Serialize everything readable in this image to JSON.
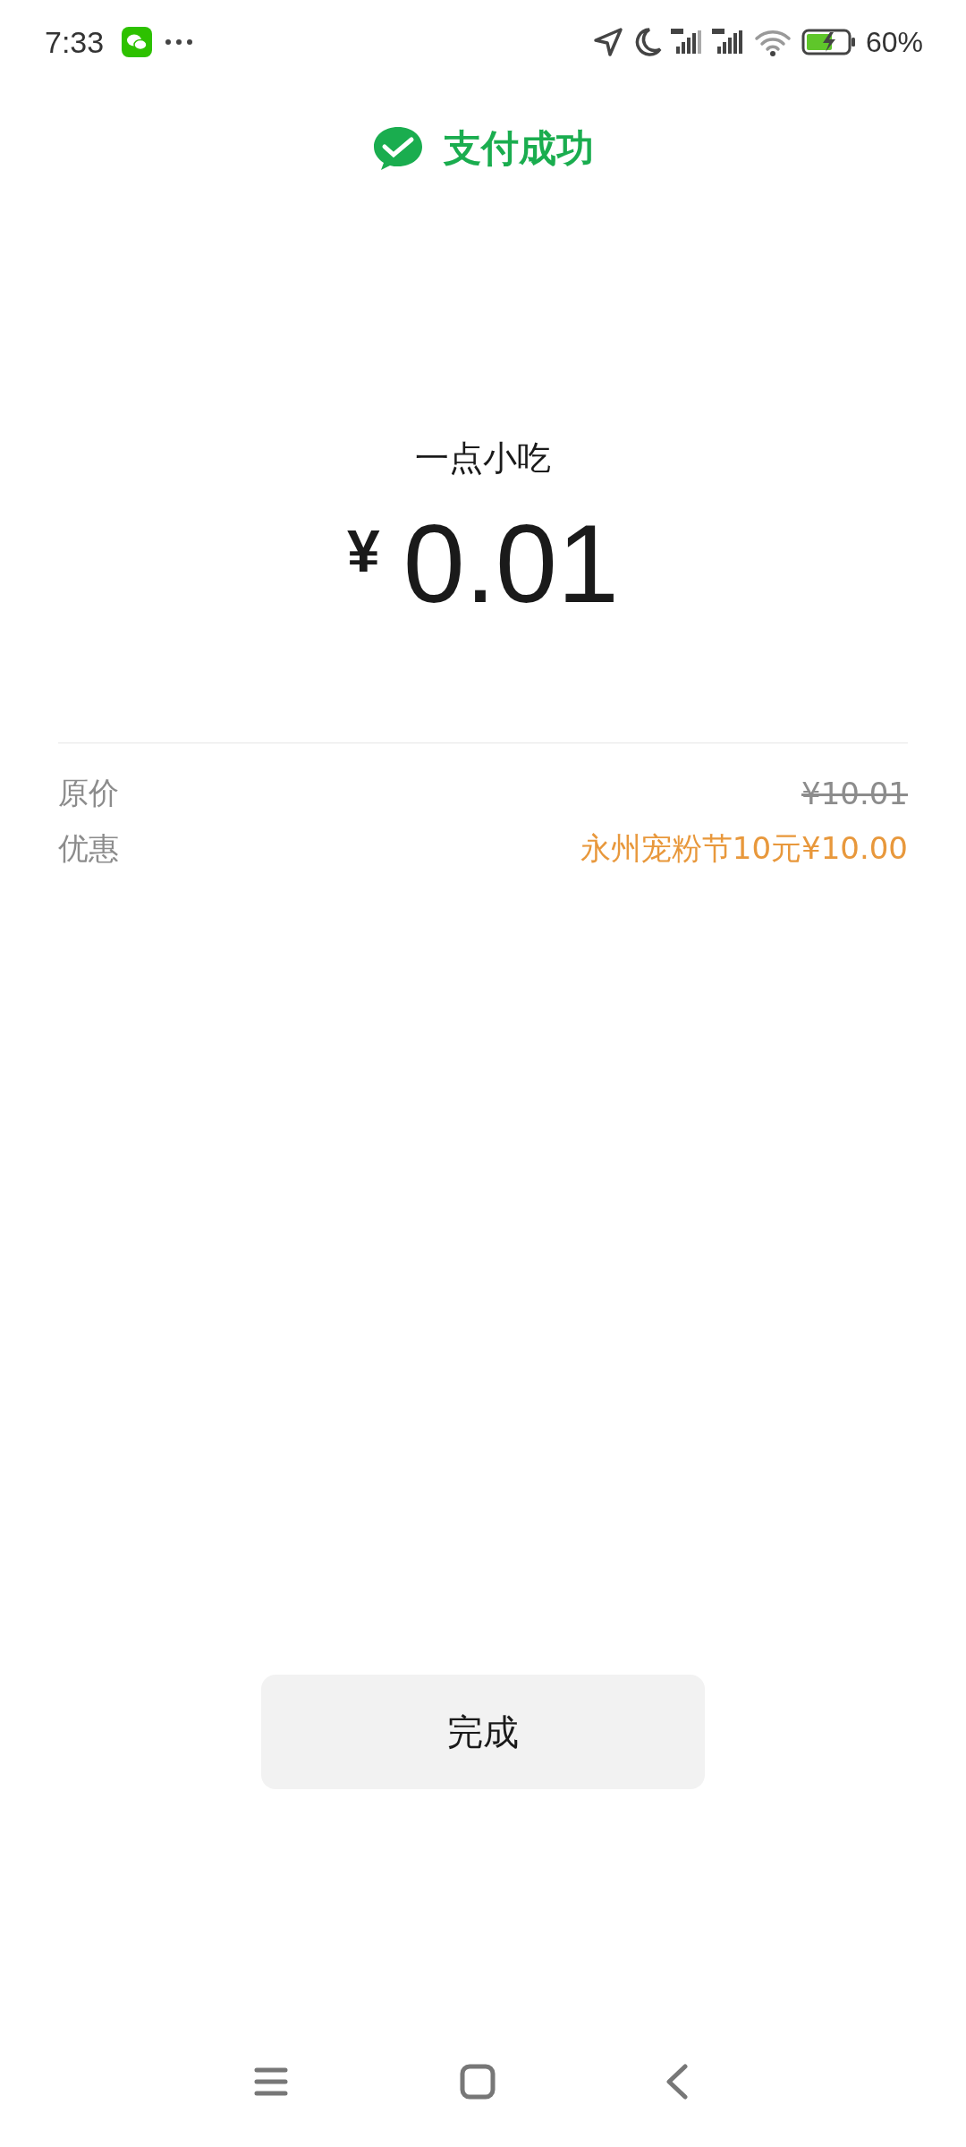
{
  "status_bar": {
    "time": "7:33",
    "battery": "60%"
  },
  "header": {
    "title": "支付成功"
  },
  "merchant": "一点小吃",
  "amount": {
    "currency": "¥",
    "value": "0.01"
  },
  "details": [
    {
      "label": "原价",
      "value": "¥10.01",
      "kind": "original"
    },
    {
      "label": "优惠",
      "value": "永州宠粉节10元¥10.00",
      "kind": "discount"
    }
  ],
  "done_button": "完成"
}
